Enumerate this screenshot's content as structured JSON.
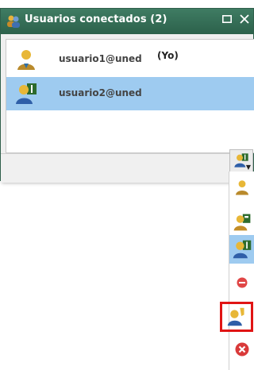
{
  "window": {
    "title": "Usuarios conectados (2)",
    "controls": {
      "maximize": "maximize-icon",
      "close": "close-icon"
    }
  },
  "users": [
    {
      "email": "usuario1@uned",
      "tag": "(Yo)",
      "icon": "user-yellow-icon"
    },
    {
      "email": "usuario2@uned",
      "tag": "",
      "icon": "user-blue-presenter-icon"
    }
  ],
  "status_button": {
    "icon": "user-blue-presenter-icon"
  },
  "status_menu": [
    {
      "icon": "user-yellow-icon"
    },
    {
      "icon": "user-yellow-presenter-icon"
    },
    {
      "icon": "user-blue-presenter-icon",
      "selected": true
    },
    {
      "icon": "minus-red-icon"
    },
    {
      "icon": "user-blue-raised-hand-icon",
      "highlighted": true
    },
    {
      "icon": "close-red-icon"
    }
  ]
}
